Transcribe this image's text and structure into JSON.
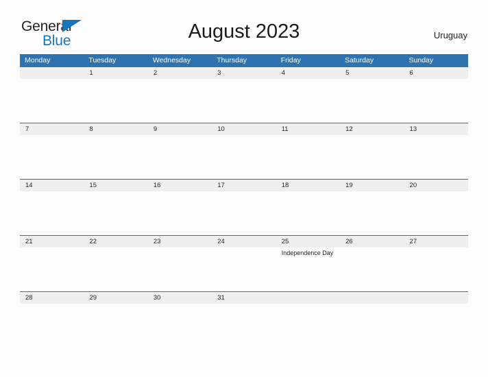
{
  "brand": {
    "line1": "General",
    "line2": "Blue",
    "flag_icon": "blue-triangle-flag",
    "color_dark": "#231F20",
    "color_blue": "#1A74BB"
  },
  "header": {
    "title": "August 2023",
    "country": "Uruguay"
  },
  "theme": {
    "header_blue": "#2F72B0",
    "band_gray": "#EFEFEF",
    "page_bg": "#FCFCFC",
    "text": "#231F20"
  },
  "calendar": {
    "weekday_headers": [
      "Monday",
      "Tuesday",
      "Wednesday",
      "Thursday",
      "Friday",
      "Saturday",
      "Sunday"
    ],
    "weeks": [
      {
        "days": [
          {
            "date": "",
            "events": []
          },
          {
            "date": "1",
            "events": []
          },
          {
            "date": "2",
            "events": []
          },
          {
            "date": "3",
            "events": []
          },
          {
            "date": "4",
            "events": []
          },
          {
            "date": "5",
            "events": []
          },
          {
            "date": "6",
            "events": []
          }
        ]
      },
      {
        "days": [
          {
            "date": "7",
            "events": []
          },
          {
            "date": "8",
            "events": []
          },
          {
            "date": "9",
            "events": []
          },
          {
            "date": "10",
            "events": []
          },
          {
            "date": "11",
            "events": []
          },
          {
            "date": "12",
            "events": []
          },
          {
            "date": "13",
            "events": []
          }
        ]
      },
      {
        "days": [
          {
            "date": "14",
            "events": []
          },
          {
            "date": "15",
            "events": []
          },
          {
            "date": "16",
            "events": []
          },
          {
            "date": "17",
            "events": []
          },
          {
            "date": "18",
            "events": []
          },
          {
            "date": "19",
            "events": []
          },
          {
            "date": "20",
            "events": []
          }
        ]
      },
      {
        "days": [
          {
            "date": "21",
            "events": []
          },
          {
            "date": "22",
            "events": []
          },
          {
            "date": "23",
            "events": []
          },
          {
            "date": "24",
            "events": []
          },
          {
            "date": "25",
            "events": [
              "Independence Day"
            ]
          },
          {
            "date": "26",
            "events": []
          },
          {
            "date": "27",
            "events": []
          }
        ]
      },
      {
        "days": [
          {
            "date": "28",
            "events": []
          },
          {
            "date": "29",
            "events": []
          },
          {
            "date": "30",
            "events": []
          },
          {
            "date": "31",
            "events": []
          },
          {
            "date": "",
            "events": []
          },
          {
            "date": "",
            "events": []
          },
          {
            "date": "",
            "events": []
          }
        ]
      }
    ]
  }
}
